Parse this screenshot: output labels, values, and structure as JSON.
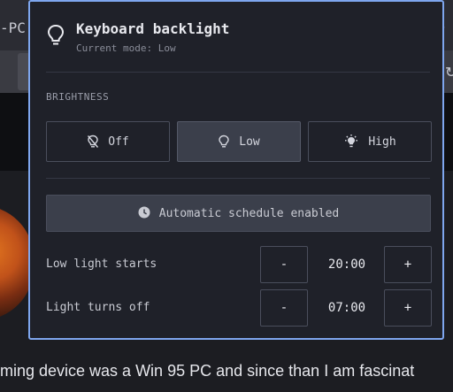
{
  "background": {
    "title_fragment": "-PC",
    "caption": "ming device was a Win 95 PC and since than I am fascinat"
  },
  "popup": {
    "title": "Keyboard backlight",
    "subtitle": "Current mode: Low",
    "icon": "lightbulb-icon",
    "section_label": "BRIGHTNESS",
    "brightness_options": [
      {
        "label": "Off",
        "icon": "lightbulb-off-icon",
        "selected": false
      },
      {
        "label": "Low",
        "icon": "lightbulb-icon",
        "selected": true
      },
      {
        "label": "High",
        "icon": "lightbulb-bright-icon",
        "selected": false
      }
    ],
    "schedule_label": "Automatic schedule enabled",
    "schedule_icon": "clock-icon",
    "low_start": {
      "label": "Low light starts",
      "value": "20:00",
      "decrement": "-",
      "increment": "+"
    },
    "turn_off": {
      "label": "Light turns off",
      "value": "07:00",
      "decrement": "-",
      "increment": "+"
    }
  },
  "colors": {
    "popup_border": "#7ea6ee",
    "popup_bg": "#1f2129",
    "active_button": "#3b3f4b"
  }
}
